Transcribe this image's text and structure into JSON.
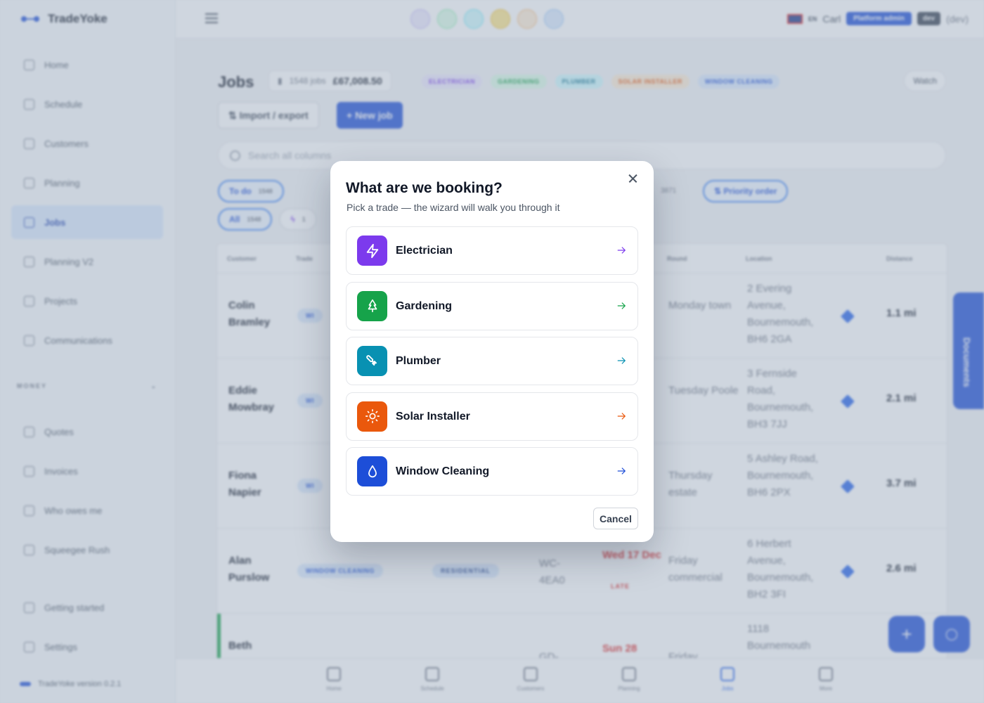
{
  "app": {
    "name": "TradeYoke",
    "version_label": "TradeYoke version 0.2.1"
  },
  "sidebar": {
    "items": [
      {
        "label": "Home"
      },
      {
        "label": "Schedule"
      },
      {
        "label": "Customers"
      },
      {
        "label": "Planning"
      },
      {
        "label": "Jobs",
        "active": true
      },
      {
        "label": "Planning V2"
      },
      {
        "label": "Projects"
      },
      {
        "label": "Communications"
      }
    ],
    "section_money": "MONEY",
    "money_items": [
      {
        "label": "Quotes"
      },
      {
        "label": "Invoices"
      },
      {
        "label": "Who owes me"
      },
      {
        "label": "Squeegee Rush"
      }
    ],
    "footer_items": [
      {
        "label": "Getting started"
      },
      {
        "label": "Settings"
      }
    ]
  },
  "topbar": {
    "user": "Carl",
    "language": "EN",
    "role_badge": "Platform admin",
    "env_badge": "dev",
    "env_paren": "(dev)"
  },
  "jobs_page": {
    "title": "Jobs",
    "job_count": "1548 jobs",
    "total_value": "£67,008.50",
    "trade_tags": [
      "ELECTRICIAN",
      "GARDENING",
      "PLUMBER",
      "SOLAR INSTALLER",
      "WINDOW CLEANING"
    ],
    "watch_label": "Watch",
    "import_label": "⇅ Import / export",
    "new_job_label": "+ New job",
    "search_placeholder": "Search all columns",
    "filter_todo": "To do",
    "filter_todo_count": "1548",
    "filter_all": "All",
    "filter_all_count": "1548",
    "filter_trade_count": "1",
    "filter_right_count": "3871",
    "priority_label": "⇅ Priority order",
    "columns": [
      "Customer",
      "Trade",
      "Round",
      "Location",
      "Distance"
    ],
    "rows": [
      {
        "name": "Colin Bramley",
        "trade": "WI",
        "round": "Monday town",
        "location": "2 Evering Avenue, Bournemouth, BH6 2GA",
        "distance": "1.1 mi"
      },
      {
        "name": "Eddie Mowbray",
        "trade": "WI",
        "round": "Tuesday Poole",
        "location": "3 Fernside Road, Bournemouth, BH3 7JJ",
        "distance": "2.1 mi"
      },
      {
        "name": "Fiona Napier",
        "trade": "WI",
        "round": "Thursday estate",
        "location": "5 Ashley Road, Bournemouth, BH6 2PX",
        "distance": "3.7 mi"
      },
      {
        "name": "Alan Purslow",
        "trade": "WINDOW CLEANING",
        "type": "RESIDENTIAL",
        "postcode": "WC-4EA0",
        "due": "Wed 17 Dec",
        "late": "LATE",
        "round": "Friday commercial",
        "location": "6 Herbert Avenue, Bournemouth, BH2 3FI",
        "distance": "2.6 mi"
      },
      {
        "name": "Beth",
        "postcode": "GD-",
        "due": "Sun 28",
        "round": "Friday",
        "location": "1118 Bournemouth",
        "distance": ""
      }
    ],
    "documents_tab": "Documents",
    "fab_add": "+"
  },
  "bottom_nav": [
    "Home",
    "Schedule",
    "Customers",
    "Planning",
    "Jobs",
    "More"
  ],
  "modal": {
    "title": "What are we booking?",
    "subtitle": "Pick a trade — the wizard will walk you through it",
    "options": [
      {
        "label": "Electrician",
        "icon": "lightning-bolt-icon",
        "color": "#7c3aed"
      },
      {
        "label": "Gardening",
        "icon": "tree-icon",
        "color": "#16a34a"
      },
      {
        "label": "Plumber",
        "icon": "wrench-icon",
        "color": "#0891b2"
      },
      {
        "label": "Solar Installer",
        "icon": "sun-icon",
        "color": "#ea580c"
      },
      {
        "label": "Window Cleaning",
        "icon": "droplet-icon",
        "color": "#1d4ed8"
      }
    ],
    "cancel_label": "Cancel"
  }
}
